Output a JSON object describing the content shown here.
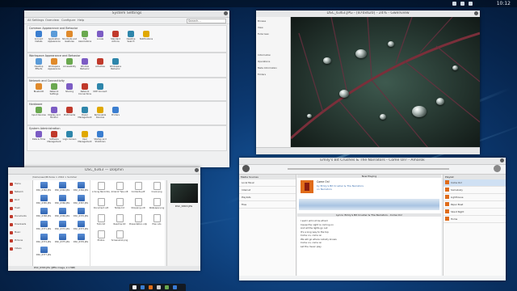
{
  "desktop": {
    "clock": "10:12"
  },
  "system_settings": {
    "title": "System Settings",
    "toolbar": [
      "All Settings",
      "Overview",
      "Configure",
      "Help"
    ],
    "search_placeholder": "Search...",
    "groups": [
      {
        "title": "Common Appearance and Behavior",
        "items": [
          "Account Details",
          "Application Appearance",
          "Shortcuts and Gestures",
          "File Associations",
          "Locale",
          "Standard Actions",
          "Desktop Search",
          "Notifications"
        ]
      },
      {
        "title": "Workspace Appearance and Behavior",
        "items": [
          "Desktop Effects",
          "Workspace Appearance",
          "Accessibility",
          "Window Behavior",
          "Activities",
          "Workspace Behavior"
        ]
      },
      {
        "title": "Network and Connectivity",
        "items": [
          "Bluetooth",
          "Network Settings",
          "Sharing",
          "Network Connections",
          "KDE Connect"
        ]
      },
      {
        "title": "Hardware",
        "items": [
          "Input Devices",
          "Display and Monitor",
          "Multimedia",
          "Power Management",
          "Removable Devices",
          "Printers"
        ]
      },
      {
        "title": "System Administration",
        "items": [
          "Date & Time",
          "Software Management",
          "Login Screen",
          "User Management",
          "Startup and Shutdown"
        ]
      }
    ]
  },
  "gwenview": {
    "title": "DSC_6363.JPG - [870x620] - 24% - Gwenview",
    "sidebar_items": [
      "Browse",
      "View",
      "Fullscreen",
      "Information",
      "Operations",
      "Meta Information",
      "Folders"
    ]
  },
  "dolphin": {
    "title": "DSC_6363 — Dolphin",
    "path": "/home/user/Pictures > 2014 > Summer",
    "places": [
      "Home",
      "Network",
      "Root",
      "Trash",
      "Documents",
      "Downloads",
      "Music",
      "Pictures",
      "Videos"
    ],
    "files": [
      "DSC_6362.JPG",
      "DSC_6363.JPG",
      "DSC_6364.JPG",
      "DSC_6365.JPG",
      "DSC_6366.JPG",
      "DSC_6367.JPG",
      "DSC_6368.JPG",
      "DSC_6369.JPG",
      "DSC_6370.JPG",
      "DSC_6371.JPG",
      "DSC_6372.JPG",
      "DSC_6373.JPG",
      "DSC_6374.JPG",
      "DSC_6375.JPG",
      "DSC_6376.JPG",
      "DSC_6377.JPG"
    ],
    "docs": [
      "A Song Recording.ogg",
      "Amarok Tips.odt",
      "Contents.pdf",
      "Cover.png",
      "Document.odt",
      "Notes.txt",
      "Shopping.odt",
      "Wallpaper.png",
      "Todo.txt",
      "Readme.txt",
      "Presentation.odp",
      "Plan.ods",
      "Photos",
      "Screenshot.png"
    ],
    "status": "DSC_6363.JPG (JPEG image, 2.1 MiB)",
    "preview_label": "DSC_6363.JPG"
  },
  "amarok": {
    "title": "Emily's Bit Crushes & The Narrators - Come On! - Amarok",
    "now_playing_header": "Now Playing",
    "track": {
      "title": "Come On!",
      "artist": "by Emily's Bit Crusher & The Narrators",
      "album": "on Narrators"
    },
    "lyrics_header": "Lyrics: Emily's Bit Crusher & The Narrators - Come On!",
    "lyrics_lines": [
      "I said I will not be afraid",
      "Cause the night is coming on",
      "And all the lights go out",
      "It's a long way to the top",
      "Come on, come on",
      "We will go where nobody knows",
      "Come on, come on",
      "Let the music play"
    ],
    "playlist_header": "Playlist",
    "playlist": [
      "Come On!",
      "Somebody",
      "Lighthouse",
      "Paper Boat",
      "Silent Night",
      "Home"
    ],
    "sources_header": "Media Sources",
    "sources": [
      "Local Music",
      "Internet",
      "Playlists",
      "Files"
    ]
  }
}
